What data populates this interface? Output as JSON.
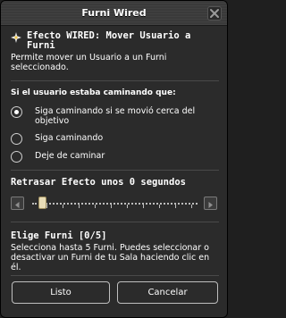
{
  "window": {
    "title": "Furni Wired",
    "close_icon": "close-icon"
  },
  "effect": {
    "icon": "wired-star-icon",
    "title": "Efecto WIRED: Mover Usuario a Furni",
    "description": "Permite mover un Usuario a un Furni seleccionado."
  },
  "walking": {
    "label": "Si el usuario estaba caminando que:",
    "options": [
      {
        "label": "Siga caminando si se movió cerca del objetivo",
        "checked": true
      },
      {
        "label": "Siga caminando",
        "checked": false
      },
      {
        "label": "Deje de caminar",
        "checked": false
      }
    ]
  },
  "delay": {
    "label": "Retrasar Efecto unos 0 segundos",
    "left_icon": "arrow-left-icon",
    "right_icon": "arrow-right-icon"
  },
  "furni": {
    "label": "Elige Furni [0/5]",
    "description": "Selecciona hasta 5 Furni. Puedes seleccionar o desactivar un Furni de tu Sala haciendo clic en él."
  },
  "buttons": {
    "ok": "Listo",
    "cancel": "Cancelar"
  }
}
